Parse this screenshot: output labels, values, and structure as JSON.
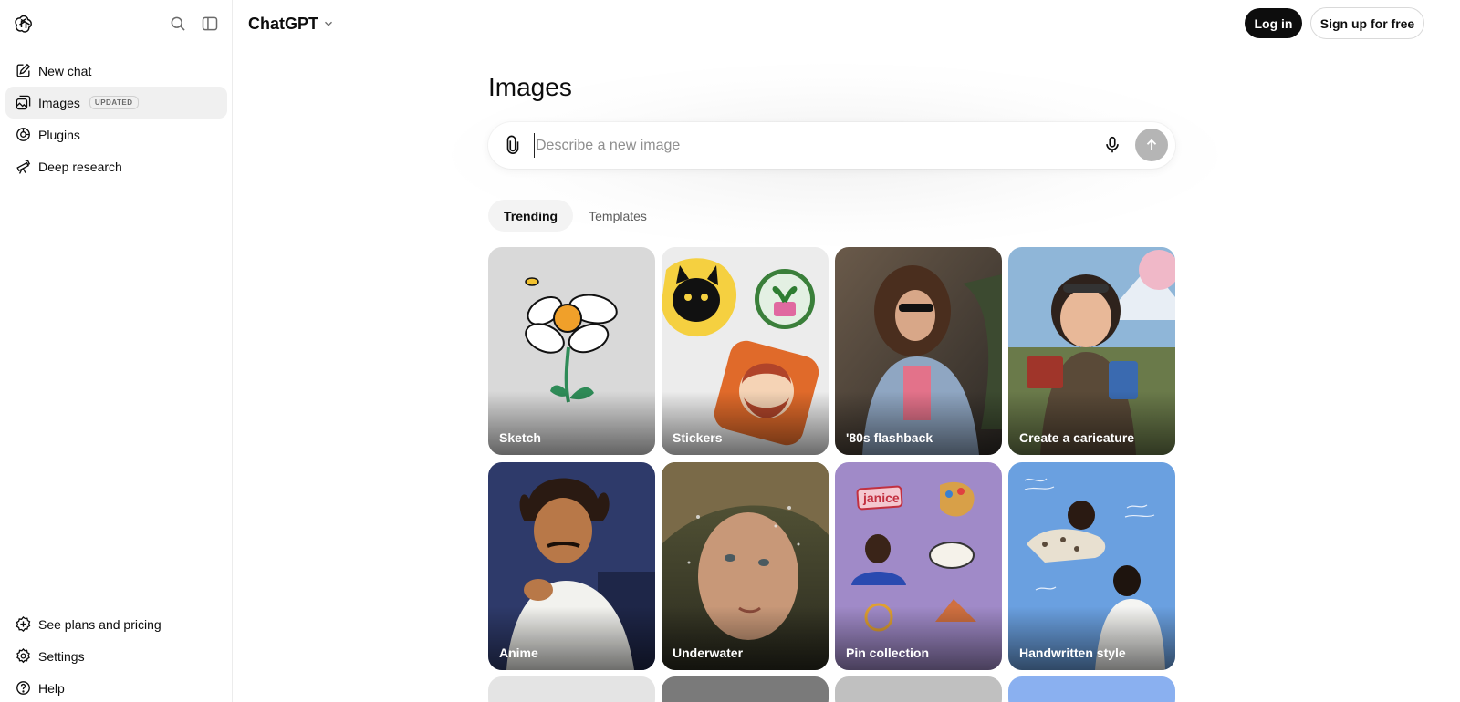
{
  "app": {
    "title": "ChatGPT"
  },
  "sidebar": {
    "items": [
      {
        "label": "New chat",
        "icon": "new-chat-icon"
      },
      {
        "label": "Images",
        "icon": "images-icon",
        "badge": "UPDATED"
      },
      {
        "label": "Plugins",
        "icon": "plugins-icon"
      },
      {
        "label": "Deep research",
        "icon": "telescope-icon"
      }
    ],
    "bottom": [
      {
        "label": "See plans and pricing",
        "icon": "plans-icon"
      },
      {
        "label": "Settings",
        "icon": "gear-icon"
      },
      {
        "label": "Help",
        "icon": "help-icon"
      }
    ]
  },
  "header": {
    "login": "Log in",
    "signup": "Sign up for free"
  },
  "main": {
    "heading": "Images",
    "composer": {
      "placeholder": "Describe a new image"
    },
    "tabs": [
      {
        "label": "Trending"
      },
      {
        "label": "Templates"
      }
    ],
    "cards": [
      {
        "label": "Sketch"
      },
      {
        "label": "Stickers"
      },
      {
        "label": "'80s flashback"
      },
      {
        "label": "Create a caricature"
      },
      {
        "label": "Anime"
      },
      {
        "label": "Underwater"
      },
      {
        "label": "Pin collection"
      },
      {
        "label": "Handwritten style"
      }
    ]
  },
  "colors": {
    "accent_dark": "#0d0d0d",
    "send_disabled": "#b5b5b5",
    "active_bg": "#f0f0f0"
  }
}
